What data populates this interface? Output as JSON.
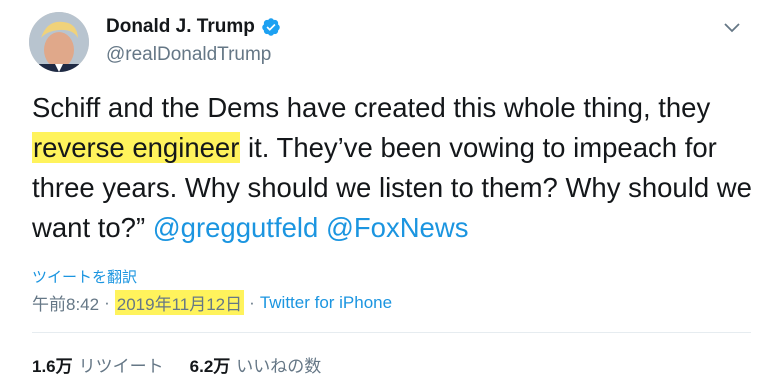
{
  "author": {
    "display_name": "Donald J. Trump",
    "handle": "@realDonaldTrump",
    "verified": true
  },
  "tweet": {
    "text_before": "Schiff and the Dems have created this whole thing, they ",
    "highlight": "reverse engineer",
    "text_after": " it. They’ve been vowing to impeach for three years. Why should we listen to them? Why should we want to?”  ",
    "mentions": [
      "@greggutfeld",
      "@FoxNews"
    ]
  },
  "translate_label": "ツイートを翻訳",
  "meta": {
    "time": "午前8:42",
    "separator": "·",
    "date": "2019年11月12日",
    "source": "Twitter for iPhone"
  },
  "stats": {
    "retweets_count": "1.6万",
    "retweets_label": "リツイート",
    "likes_count": "6.2万",
    "likes_label": "いいねの数"
  },
  "colors": {
    "link": "#1b95e0",
    "secondary": "#657786",
    "highlight": "#fff35c",
    "verified": "#1da1f2"
  },
  "icons": [
    "avatar",
    "verified-badge-icon",
    "chevron-down-icon"
  ]
}
